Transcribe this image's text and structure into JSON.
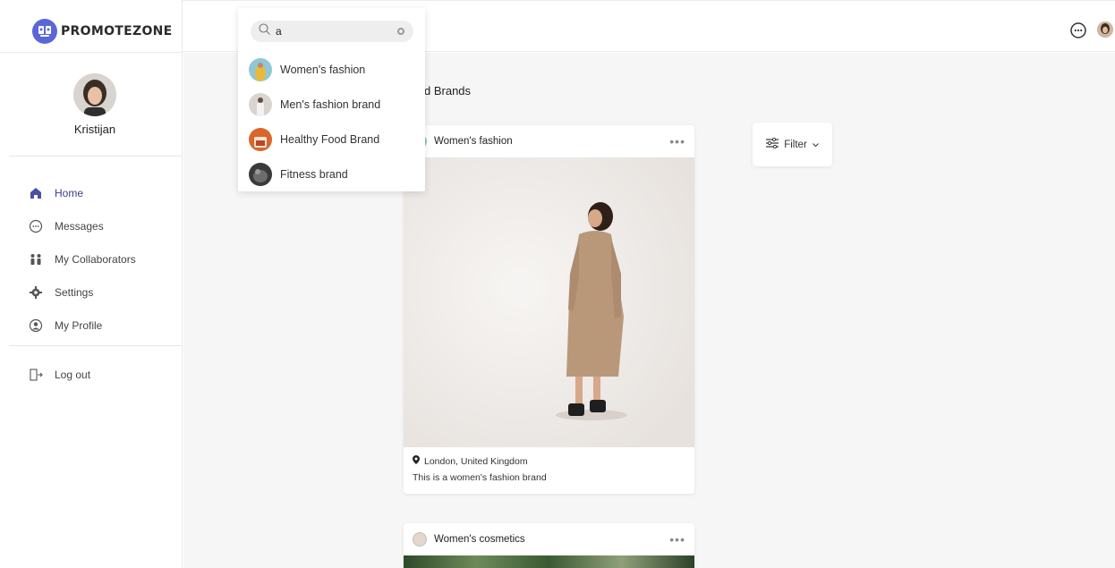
{
  "app": {
    "logo_text": "PROMOTEZONE"
  },
  "profile": {
    "name": "Kristijan"
  },
  "nav": {
    "items": [
      {
        "label": "Home",
        "icon": "home-icon",
        "active": true
      },
      {
        "label": "Messages",
        "icon": "chat-bubble-icon"
      },
      {
        "label": "My Collaborators",
        "icon": "collaborators-icon"
      },
      {
        "label": "Settings",
        "icon": "gear-icon"
      },
      {
        "label": "My Profile",
        "icon": "user-circle-icon"
      }
    ],
    "logout_label": "Log out"
  },
  "search": {
    "value": "a",
    "results": [
      {
        "label": "Women's fashion"
      },
      {
        "label": "Men's fashion brand"
      },
      {
        "label": "Healthy Food Brand"
      },
      {
        "label": "Fitness brand"
      }
    ]
  },
  "main": {
    "title_visible": "d Brands",
    "filter_label": "Filter"
  },
  "cards": [
    {
      "brand": "Women's fashion",
      "more": "•••",
      "location": "London, United Kingdom",
      "description": "This is a women's fashion brand"
    },
    {
      "brand": "Women's cosmetics",
      "more": "•••"
    }
  ],
  "colors": {
    "accent": "#5a67d8",
    "active_nav": "#3c3c8c",
    "background": "#f6f6f6"
  }
}
